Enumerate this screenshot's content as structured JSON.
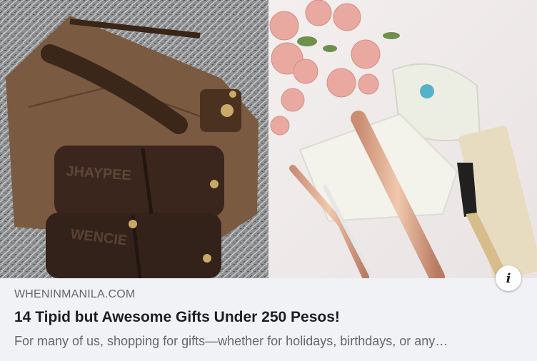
{
  "link_preview": {
    "domain": "WHENINMANILA.COM",
    "title": "14 Tipid but Awesome Gifts Under 250 Pesos!",
    "description": "For many of us, shopping for gifts—whether for holidays, birthdays, or any…",
    "info_icon": "info-icon",
    "info_glyph": "i"
  },
  "photo": {
    "leather_tag_top": "JHAYPEE",
    "leather_tag_bottom": "WENCIE"
  }
}
